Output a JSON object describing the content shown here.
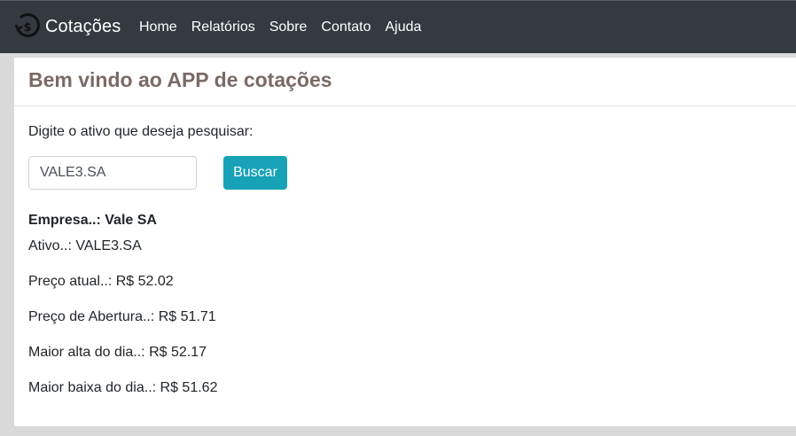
{
  "navbar": {
    "brand": "Cotações",
    "brand_icon": "currency-refresh-icon",
    "links": [
      "Home",
      "Relatórios",
      "Sobre",
      "Contato",
      "Ajuda"
    ]
  },
  "main": {
    "title": "Bem vindo ao APP de cotações",
    "prompt": "Digite o ativo que deseja pesquisar:",
    "search_value": "VALE3.SA",
    "search_button": "Buscar",
    "results": {
      "empresa": "Empresa..: Vale SA",
      "ativo": "Ativo..: VALE3.SA",
      "preco_atual": "Preço atual..: R$ 52.02",
      "preco_abertura": "Preço de Abertura..: R$ 51.71",
      "maior_alta": "Maior alta do dia..: R$ 52.17",
      "maior_baixa": "Maior baixa do dia..: R$ 51.62"
    }
  },
  "colors": {
    "navbar_bg": "#343a40",
    "title_color": "#7a6a66",
    "button_bg": "#17a2b8",
    "page_bg": "#d9d9d9"
  }
}
